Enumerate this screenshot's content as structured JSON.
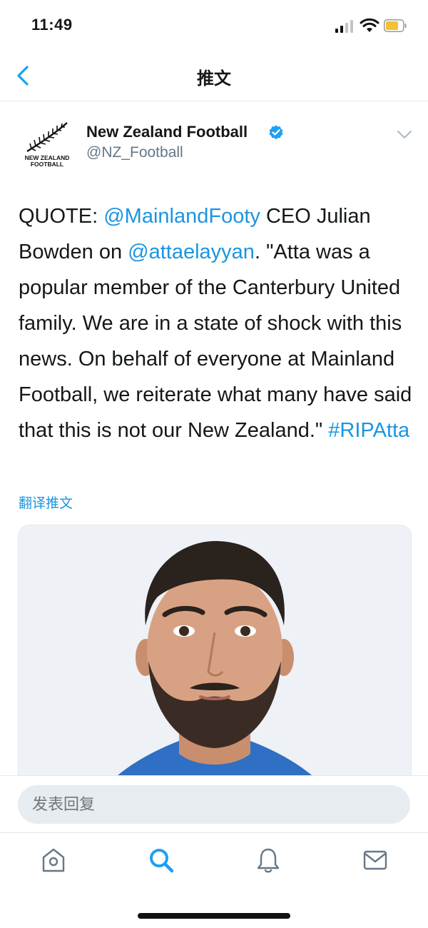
{
  "status_bar": {
    "time": "11:49"
  },
  "nav": {
    "title": "推文"
  },
  "tweet": {
    "avatar_text_line1": "NEW ZEALAND",
    "avatar_text_line2": "FOOTBALL",
    "display_name": "New Zealand Football",
    "handle": "@NZ_Football",
    "text_parts": {
      "p1": "QUOTE: ",
      "mention1": "@MainlandFooty",
      "p2": " CEO Julian Bowden on ",
      "mention2": "@attaelayyan",
      "p3": ". \"Atta was a popular member of the Canterbury United family. We are in a state of shock with this news. On behalf of everyone at Mainland Football, we reiterate what many have said that this is not our New Zealand.\" ",
      "hashtag": "#RIPAtta"
    },
    "translate_label": "翻译推文"
  },
  "reply": {
    "placeholder": "发表回复"
  },
  "colors": {
    "link": "#1b95e0",
    "verified": "#1da1f2",
    "text": "#14171a",
    "secondary": "#657786"
  },
  "tabs": {
    "home": "home-icon",
    "search": "search-icon",
    "notifications": "bell-icon",
    "messages": "envelope-icon"
  }
}
